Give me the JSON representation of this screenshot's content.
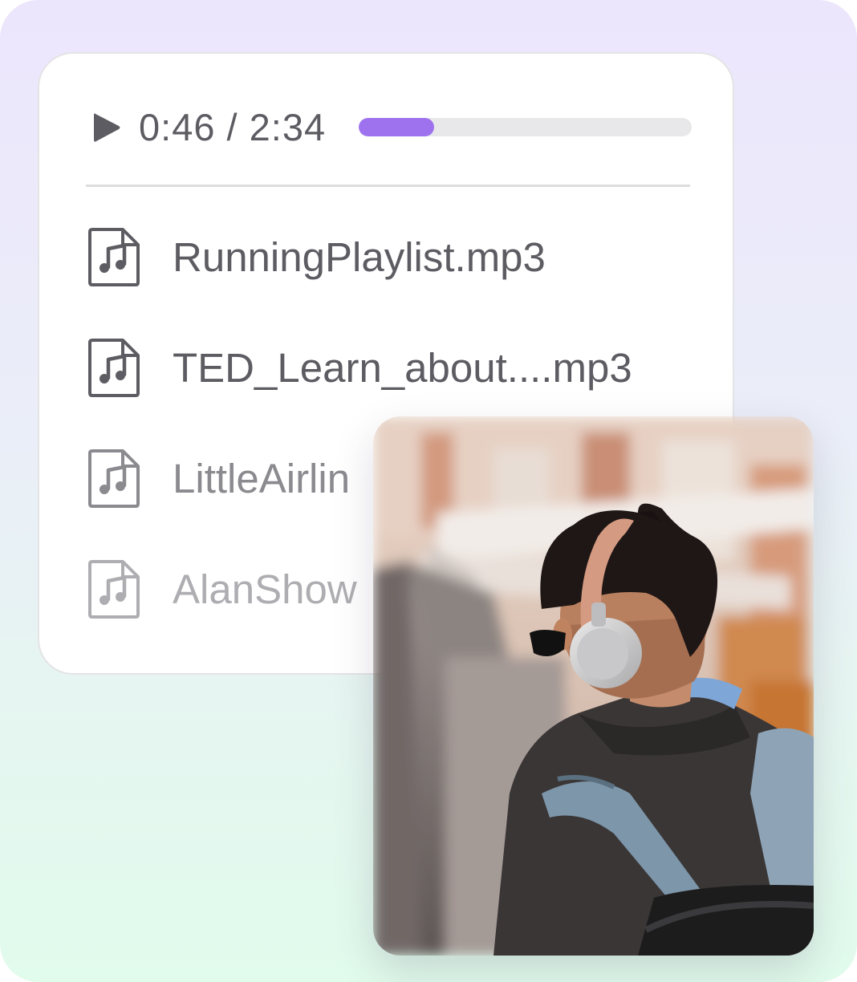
{
  "player": {
    "play_icon": "play-icon",
    "time_label": "0:46 / 2:34",
    "progress": 0.226,
    "accent_color": "#9e72ee"
  },
  "files": [
    {
      "name": "RunningPlaylist.mp3",
      "icon": "music-file-icon",
      "color": "#5c5c62"
    },
    {
      "name": "TED_Learn_about....mp3",
      "icon": "music-file-icon",
      "color": "#5c5c62"
    },
    {
      "name": "LittleAirlin",
      "icon": "music-file-icon",
      "color": "#8a8a8f"
    },
    {
      "name": "AlanShow",
      "icon": "music-file-icon",
      "color": "#aeaeb2"
    }
  ],
  "photo": {
    "description_icon": "person-with-headphones-photo"
  }
}
